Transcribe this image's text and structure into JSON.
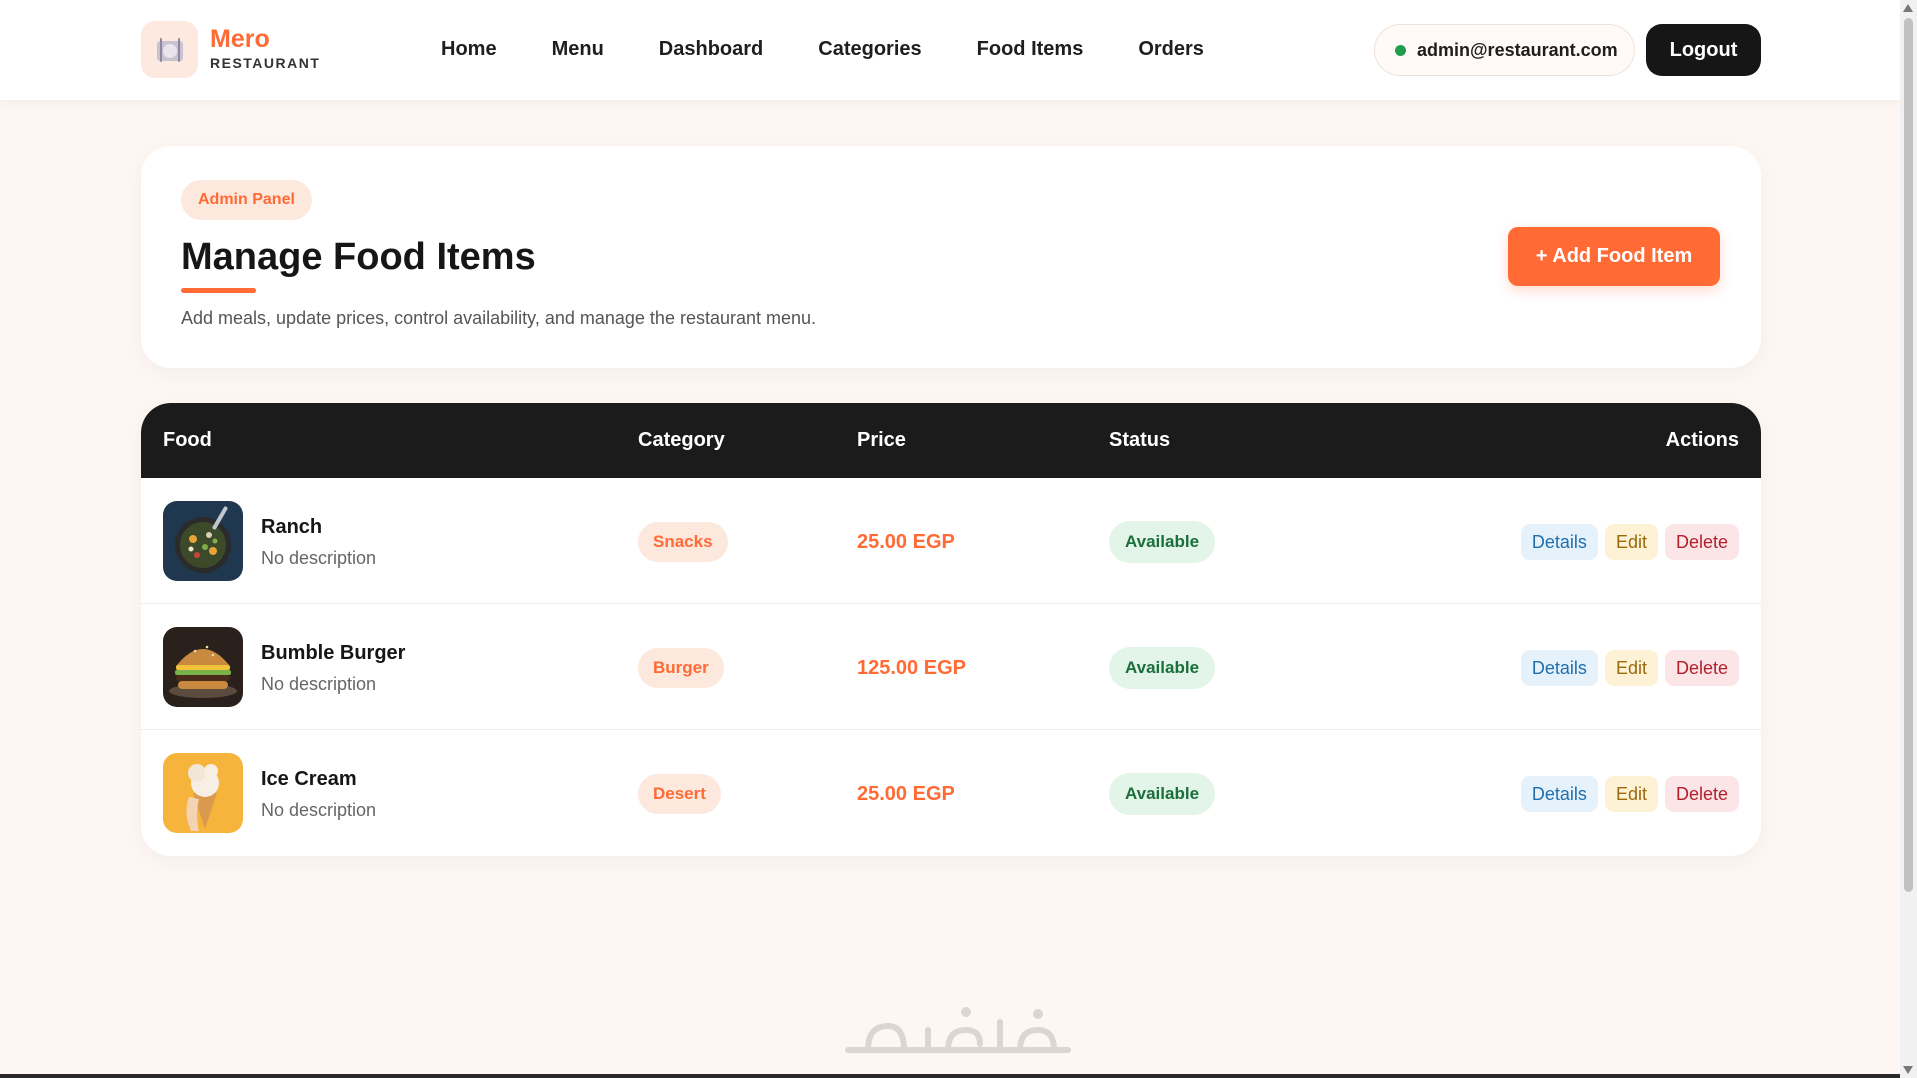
{
  "brand": {
    "name": "Mero",
    "subtitle": "RESTAURANT",
    "icon": "plate-cutlery-icon",
    "accent_color": "#ff6a35"
  },
  "nav": {
    "links": [
      "Home",
      "Menu",
      "Dashboard",
      "Categories",
      "Food Items",
      "Orders"
    ],
    "user_email": "admin@restaurant.com",
    "online_color": "#1f9d4b",
    "logout_label": "Logout"
  },
  "header": {
    "badge": "Admin Panel",
    "title": "Manage Food Items",
    "subtitle": "Add meals, update prices, control availability, and manage the restaurant menu.",
    "add_button": "+ Add Food Item"
  },
  "table": {
    "columns": {
      "food": "Food",
      "category": "Category",
      "price": "Price",
      "status": "Status",
      "actions": "Actions"
    },
    "action_labels": {
      "details": "Details",
      "edit": "Edit",
      "delete": "Delete"
    },
    "rows": [
      {
        "name": "Ranch",
        "description": "No description",
        "category": "Snacks",
        "price": "25.00 EGP",
        "status": "Available",
        "image": "salad-bowl-image"
      },
      {
        "name": "Bumble Burger",
        "description": "No description",
        "category": "Burger",
        "price": "125.00 EGP",
        "status": "Available",
        "image": "burger-image"
      },
      {
        "name": "Ice Cream",
        "description": "No description",
        "category": "Desert",
        "price": "25.00 EGP",
        "status": "Available",
        "image": "ice-cream-cone-image"
      }
    ]
  },
  "watermark": {
    "icon": "khamsat-logo-watermark"
  }
}
